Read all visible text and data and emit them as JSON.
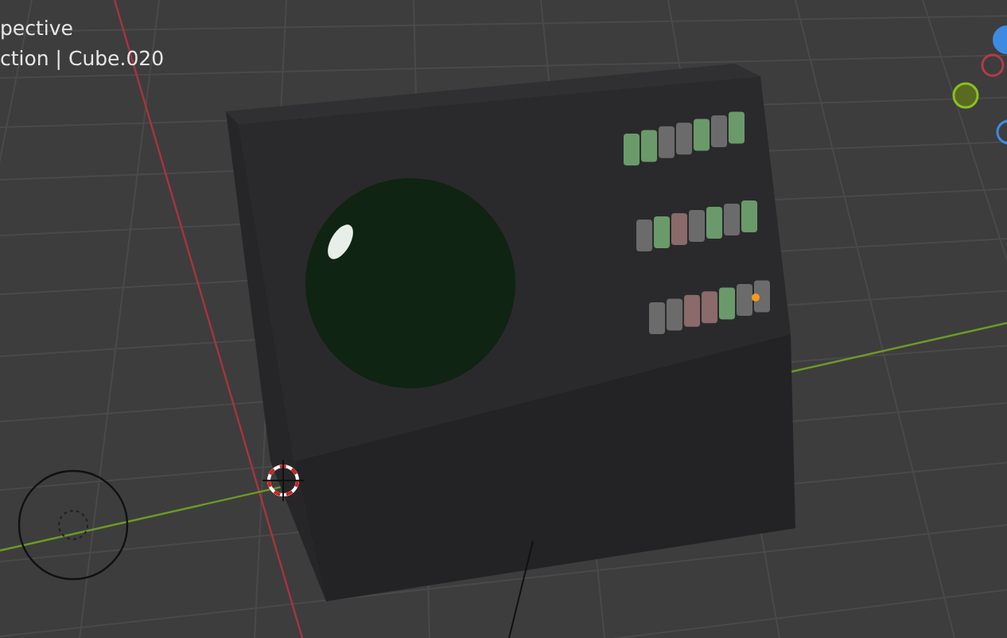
{
  "viewport": {
    "view_name": "pective",
    "object_path": "ction | Cube.020"
  }
}
